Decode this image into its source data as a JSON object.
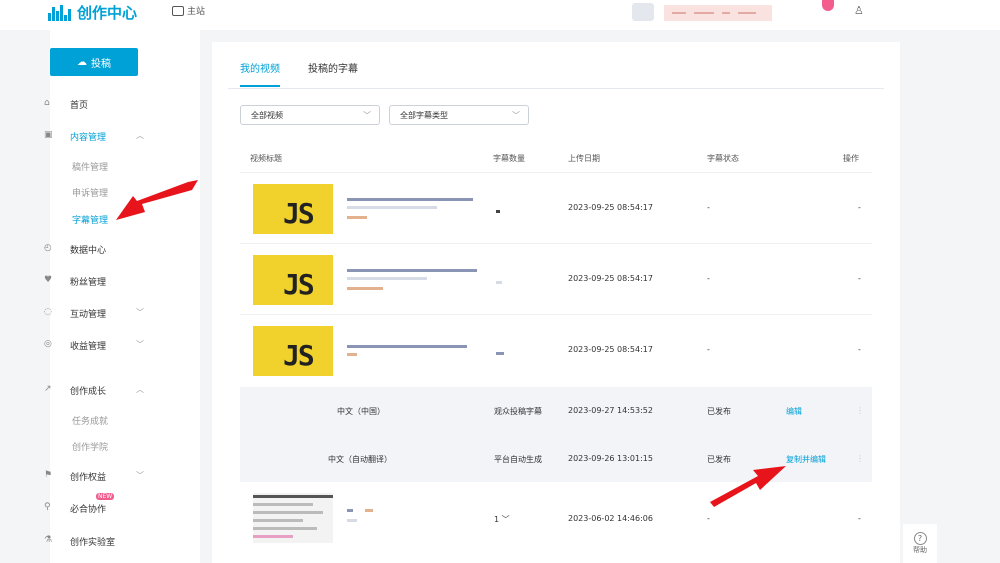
{
  "topbar": {
    "app_title": "创作中心",
    "home_label": "主站"
  },
  "sidebar": {
    "upload_label": "投稿",
    "items": [
      {
        "label": "首页"
      },
      {
        "label": "内容管理"
      },
      {
        "label": "数据中心"
      },
      {
        "label": "粉丝管理"
      },
      {
        "label": "互动管理"
      },
      {
        "label": "收益管理"
      },
      {
        "label": "创作成长"
      },
      {
        "label": "创作权益"
      },
      {
        "label": "必合协作"
      },
      {
        "label": "创作实验室"
      }
    ],
    "content_sub": [
      {
        "label": "稿件管理"
      },
      {
        "label": "申诉管理"
      },
      {
        "label": "字幕管理"
      }
    ],
    "growth_sub": [
      {
        "label": "任务成就"
      },
      {
        "label": "创作学院"
      }
    ],
    "new_badge": "NEW"
  },
  "main": {
    "tabs": [
      {
        "label": "我的视频"
      },
      {
        "label": "投稿的字幕"
      }
    ],
    "filter_video": "全部视频",
    "filter_subtitle": "全部字幕类型",
    "columns": {
      "title": "视频标题",
      "count": "字幕数量",
      "date": "上传日期",
      "status": "字幕状态",
      "action": "操作"
    },
    "video_rows": [
      {
        "date": "2023-09-25 08:54:17",
        "status": "-",
        "action": "-"
      },
      {
        "date": "2023-09-25 08:54:17",
        "status": "-",
        "action": "-"
      },
      {
        "date": "2023-09-25 08:54:17",
        "status": "-",
        "action": "-"
      }
    ],
    "subtitle_rows": [
      {
        "lang": "中文（中国）",
        "type": "观众投稿字幕",
        "date": "2023-09-27 14:53:52",
        "status": "已发布",
        "action": "编辑"
      },
      {
        "lang": "中文（自动翻译）",
        "type": "平台自动生成",
        "date": "2023-09-26 13:01:15",
        "status": "已发布",
        "action": "复制并编辑"
      }
    ],
    "last_row": {
      "count": "1",
      "date": "2023-06-02 14:46:06",
      "status": "-",
      "action": "-"
    }
  },
  "help_label": "帮助"
}
